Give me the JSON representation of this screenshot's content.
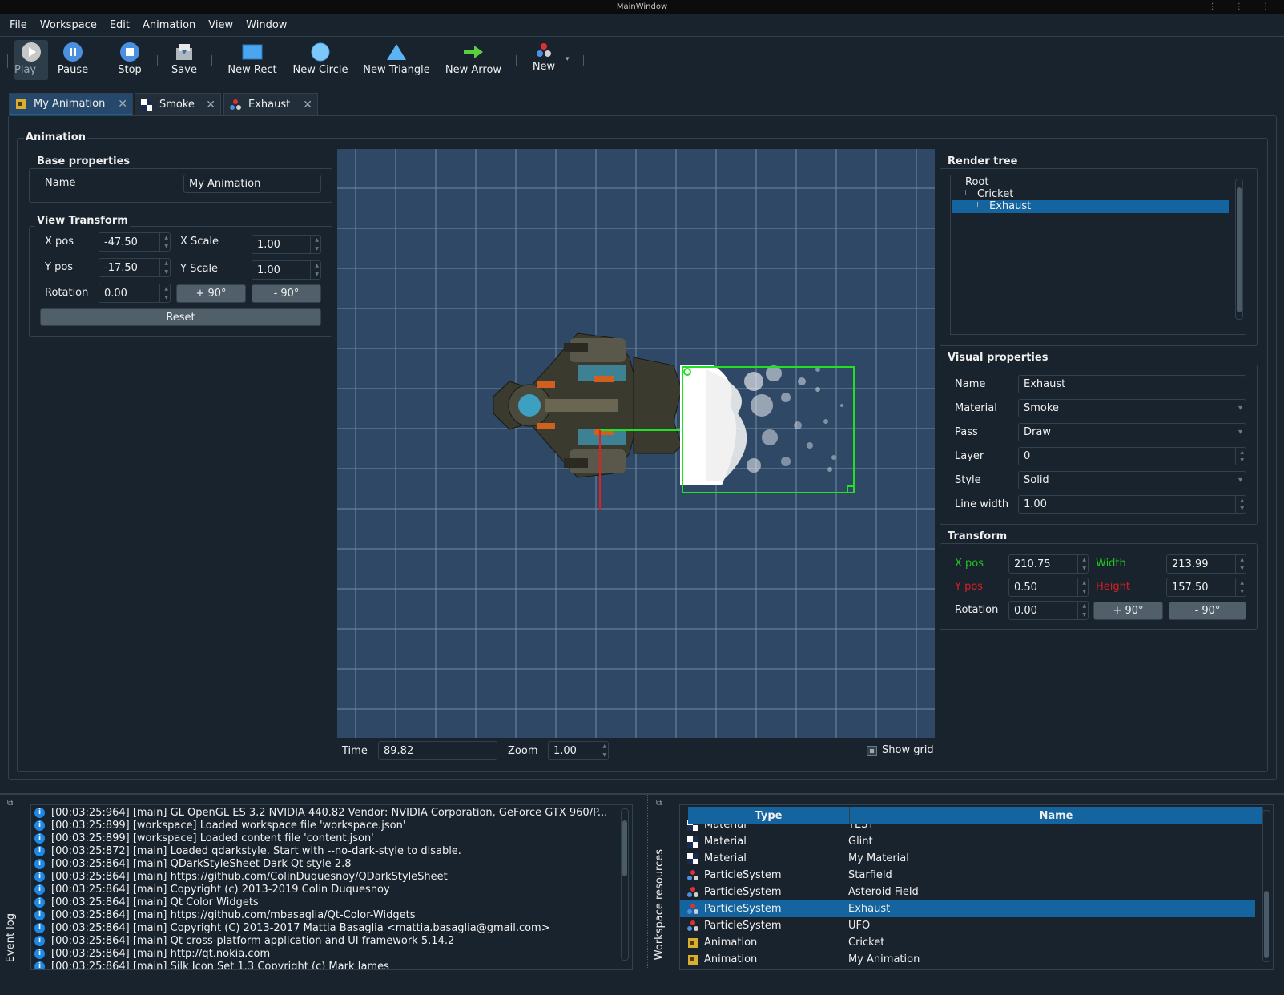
{
  "window": {
    "title": "MainWindow"
  },
  "menu": [
    "File",
    "Workspace",
    "Edit",
    "Animation",
    "View",
    "Window"
  ],
  "toolbar": {
    "play": "Play",
    "pause": "Pause",
    "stop": "Stop",
    "save": "Save",
    "new_rect": "New Rect",
    "new_circle": "New Circle",
    "new_triangle": "New Triangle",
    "new_arrow": "New Arrow",
    "new": "New"
  },
  "tabs": [
    {
      "label": "My Animation",
      "icon": "animation-icon",
      "selected": true
    },
    {
      "label": "Smoke",
      "icon": "material-icon",
      "selected": false
    },
    {
      "label": "Exhaust",
      "icon": "particle-icon",
      "selected": false
    }
  ],
  "animation": {
    "group_title": "Animation",
    "base": {
      "title": "Base  properties",
      "name_label": "Name",
      "name_value": "My Animation"
    },
    "view_transform": {
      "title": "View Transform",
      "xpos_label": "X pos",
      "xpos": "-47.50",
      "ypos_label": "Y pos",
      "ypos": "-17.50",
      "rotation_label": "Rotation",
      "rotation": "0.00",
      "xscale_label": "X Scale",
      "xscale": "1.00",
      "yscale_label": "Y Scale",
      "yscale": "1.00",
      "plus90": "+ 90°",
      "minus90": "- 90°",
      "reset": "Reset"
    }
  },
  "viewport_footer": {
    "time_label": "Time",
    "time": "89.82",
    "zoom_label": "Zoom",
    "zoom": "1.00",
    "show_grid": "Show grid",
    "show_grid_checked": true
  },
  "render_tree": {
    "title": "Render tree",
    "items": [
      "Root",
      "Cricket",
      "Exhaust"
    ],
    "selected": "Exhaust"
  },
  "visual": {
    "title": "Visual properties",
    "name_label": "Name",
    "name": "Exhaust",
    "material_label": "Material",
    "material": "Smoke",
    "pass_label": "Pass",
    "pass": "Draw",
    "layer_label": "Layer",
    "layer": "0",
    "style_label": "Style",
    "style": "Solid",
    "linewidth_label": "Line width",
    "linewidth": "1.00"
  },
  "transform": {
    "title": "Transform",
    "xpos_label": "X pos",
    "xpos": "210.75",
    "ypos_label": "Y pos",
    "ypos": "0.50",
    "width_label": "Width",
    "width": "213.99",
    "height_label": "Height",
    "height": "157.50",
    "rotation_label": "Rotation",
    "rotation": "0.00",
    "plus90": "+ 90°",
    "minus90": "- 90°",
    "colors": {
      "x": "#1ec81e",
      "y": "#dc1e1e"
    }
  },
  "event_log": {
    "dock_title": "Event log",
    "rows": [
      "[00:03:25:964] [main] GL OpenGL ES 3.2 NVIDIA 440.82 Vendor: NVIDIA Corporation, GeForce GTX 960/P...",
      "[00:03:25:899] [workspace] Loaded workspace file 'workspace.json'",
      "[00:03:25:899] [workspace] Loaded content file 'content.json'",
      "[00:03:25:872] [main] Loaded qdarkstyle. Start with --no-dark-style to disable.",
      "[00:03:25:864] [main] QDarkStyleSheet Dark Qt style 2.8",
      "[00:03:25:864] [main] https://github.com/ColinDuquesnoy/QDarkStyleSheet",
      "[00:03:25:864] [main] Copyright (c) 2013-2019 Colin Duquesnoy",
      "[00:03:25:864] [main] Qt Color Widgets",
      "[00:03:25:864] [main] https://github.com/mbasaglia/Qt-Color-Widgets",
      "[00:03:25:864] [main] Copyright (C) 2013-2017 Mattia Basaglia <mattia.basaglia@gmail.com>",
      "[00:03:25:864] [main] Qt cross-platform application and UI framework 5.14.2",
      "[00:03:25:864] [main] http://qt.nokia.com",
      "[00:03:25:864] [main] Silk Icon Set 1.3 Copyright (c) Mark James"
    ]
  },
  "resources": {
    "dock_title": "Workspace resources",
    "col_type": "Type",
    "col_name": "Name",
    "rows": [
      {
        "type": "Material",
        "name": "TEST",
        "icon": "material-icon"
      },
      {
        "type": "Material",
        "name": "Glint",
        "icon": "material-icon"
      },
      {
        "type": "Material",
        "name": "My Material",
        "icon": "material-icon"
      },
      {
        "type": "ParticleSystem",
        "name": "Starfield",
        "icon": "particle-icon"
      },
      {
        "type": "ParticleSystem",
        "name": "Asteroid Field",
        "icon": "particle-icon"
      },
      {
        "type": "ParticleSystem",
        "name": "Exhaust",
        "icon": "particle-icon",
        "selected": true
      },
      {
        "type": "ParticleSystem",
        "name": "UFO",
        "icon": "particle-icon"
      },
      {
        "type": "Animation",
        "name": "Cricket",
        "icon": "animation-icon"
      },
      {
        "type": "Animation",
        "name": "My Animation",
        "icon": "animation-icon"
      }
    ]
  }
}
